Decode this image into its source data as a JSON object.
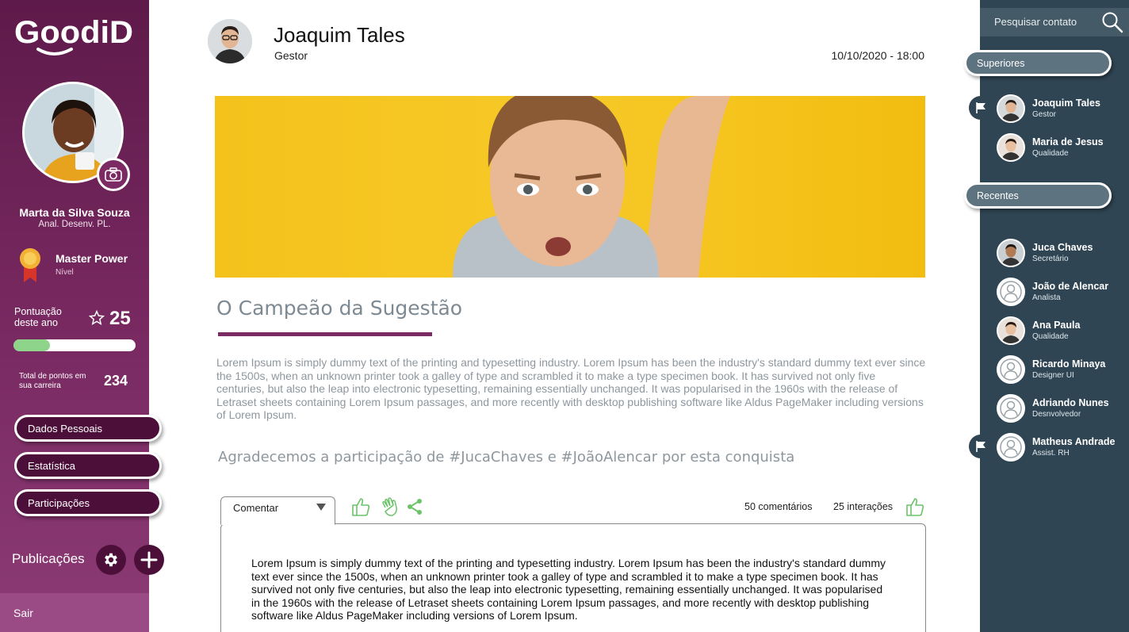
{
  "sidebar": {
    "logo": "GoodiD",
    "user": {
      "name": "Marta da Silva Souza",
      "role": "Anal. Desenv. PL."
    },
    "level": {
      "name": "Master Power",
      "label": "Nível"
    },
    "score": {
      "label": "Pontuação deste ano",
      "value": "25",
      "progress": 0.3
    },
    "total": {
      "label": "Total de pontos em sua carreira",
      "value": "234"
    },
    "nav": [
      {
        "label": "Dados Pessoais"
      },
      {
        "label": "Estatística"
      },
      {
        "label": "Participações"
      }
    ],
    "publications_label": "Publicações",
    "logout_label": "Sair"
  },
  "post": {
    "author_name": "Joaquim Tales",
    "author_role": "Gestor",
    "date": "10/10/2020 - 18:00",
    "title": "O Campeão da Sugestão",
    "body": "Lorem Ipsum is simply dummy text of the printing and typesetting industry. Lorem Ipsum has been the industry's standard dummy text ever since the 1500s, when an unknown printer took a galley of type and scrambled it to make a type specimen book. It has survived not only five centuries, but also the leap into electronic typesetting, remaining essentially unchanged. It was popularised in the 1960s with the release of Letraset sheets containing Lorem Ipsum passages, and more recently with desktop publishing software like Aldus PageMaker including versions of Lorem Ipsum.",
    "thanks": "Agradecemos a participação de #JucaChaves e #JoãoAlencar por esta conquista",
    "comment_tab": "Comentar",
    "comments_count": "50 comentários",
    "interactions_count": "25 interações",
    "comment_text": "Lorem Ipsum is simply dummy text of the printing and typesetting industry. Lorem Ipsum has been the industry's standard dummy text ever since the 1500s, when an unknown printer took a galley of type and scrambled it to make a type specimen book. It has survived not only five centuries, but also the leap into electronic typesetting, remaining essentially unchanged. It was popularised in the 1960s with the release of Letraset sheets containing Lorem Ipsum passages, and more recently with desktop publishing software like Aldus PageMaker including versions of Lorem Ipsum."
  },
  "contacts": {
    "search_placeholder": "Pesquisar contato",
    "superiors_label": "Superiores",
    "recent_label": "Recentes",
    "superiors": [
      {
        "name": "Joaquim Tales",
        "role": "Gestor",
        "flagged": true
      },
      {
        "name": "Maria de Jesus",
        "role": "Qualidade",
        "flagged": false
      }
    ],
    "recent": [
      {
        "name": "Juca Chaves",
        "role": "Secretário",
        "flagged": false
      },
      {
        "name": "João de Alencar",
        "role": "Analista",
        "flagged": false
      },
      {
        "name": "Ana Paula",
        "role": "Qualidade",
        "flagged": false
      },
      {
        "name": "Ricardo Minaya",
        "role": "Designer UI",
        "flagged": false
      },
      {
        "name": "Adriando Nunes",
        "role": "Desnvolvedor",
        "flagged": false
      },
      {
        "name": "Matheus Andrade",
        "role": "Assist. RH",
        "flagged": true
      }
    ]
  },
  "colors": {
    "brand": "#7b2a63",
    "panel": "#2f4553",
    "accent_green": "#8ed48a",
    "banner_yellow": "#f4c21b"
  }
}
